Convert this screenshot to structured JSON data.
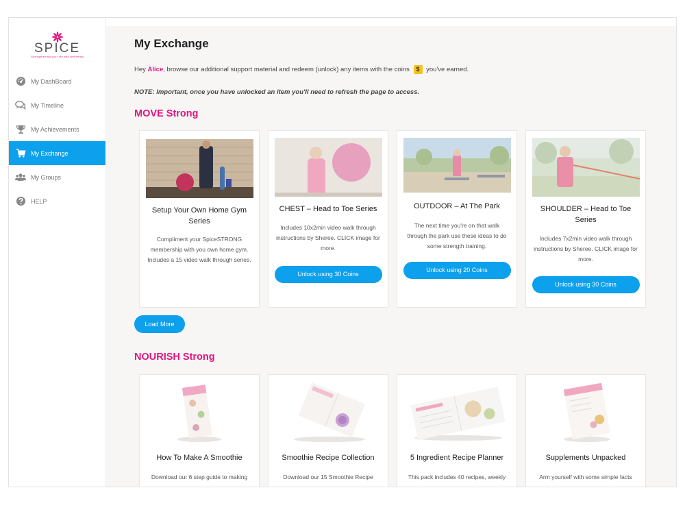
{
  "brand": {
    "name": "SPICE",
    "tagline": "Strengthening your life and wellbeing"
  },
  "sidebar": {
    "items": [
      {
        "label": "My DashBoard",
        "icon": "dashboard-icon"
      },
      {
        "label": "My Timeline",
        "icon": "comments-icon"
      },
      {
        "label": "My Achievements",
        "icon": "trophy-icon"
      },
      {
        "label": "My Exchange",
        "icon": "cart-icon",
        "active": true
      },
      {
        "label": "My Groups",
        "icon": "users-icon"
      },
      {
        "label": "HELP",
        "icon": "help-icon"
      }
    ]
  },
  "page": {
    "title": "My Exchange",
    "intro_prefix": "Hey ",
    "user_name": "Alice",
    "intro_middle": ", browse our additional support material and redeem (unlock) any items with the coins ",
    "coin_symbol": "$",
    "intro_suffix": " you've earned.",
    "note": "NOTE: Important, once you have unlocked an item you'll need to refresh the page to access."
  },
  "move": {
    "heading": "MOVE Strong",
    "cards": [
      {
        "title": "Setup Your Own Home Gym Series",
        "desc": "Compliment your SpiceSTRONG membership with you own home gym. Includes a 15 video walk through series.",
        "button": ""
      },
      {
        "title": "CHEST – Head to Toe Series",
        "desc": "Includes 10x2min video walk through instructions by Sheree. CLICK image for more.",
        "button": "Unlock using 30 Coins"
      },
      {
        "title": "OUTDOOR – At The Park",
        "desc": "The next time you're on that walk through the park use these ideas to do some strength training.",
        "button": "Unlock using 20 Coins"
      },
      {
        "title": "SHOULDER – Head to Toe Series",
        "desc": "Includes 7x2min video walk through instructions by Sheree. CLICK image for more.",
        "button": "Unlock using 30 Coins"
      }
    ],
    "load_more": "Load More"
  },
  "nourish": {
    "heading": "NOURISH Strong",
    "cards": [
      {
        "title": "How To Make A Smoothie",
        "desc": "Download our 6 step guide to making"
      },
      {
        "title": "Smoothie Recipe Collection",
        "desc": "Download our 15 Smoothie Recipe"
      },
      {
        "title": "5 Ingredient Recipe Planner",
        "desc": "This pack includes 40 recipes, weekly"
      },
      {
        "title": "Supplements Unpacked",
        "desc": "Arm yourself with some simple facts"
      }
    ]
  },
  "colors": {
    "accent": "#0da0ec",
    "brand_pink": "#e0157f",
    "coin": "#f8c21a"
  }
}
